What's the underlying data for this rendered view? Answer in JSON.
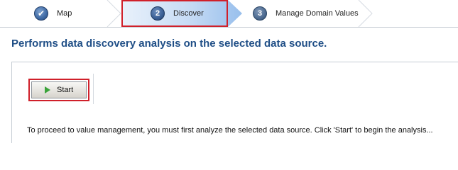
{
  "wizard": {
    "steps": [
      {
        "number": "1",
        "label": "Map",
        "icon": "check-icon",
        "state": "completed"
      },
      {
        "number": "2",
        "label": "Discover",
        "state": "active"
      },
      {
        "number": "3",
        "label": "Manage Domain Values",
        "state": "pending"
      }
    ]
  },
  "main": {
    "title": "Performs data discovery analysis on the selected data source.",
    "toolbar": {
      "start_label": "Start",
      "start_icon": "play-icon"
    },
    "instructions": "To proceed to value management, you must first analyze the selected data source. Click 'Start' to begin the analysis..."
  },
  "colors": {
    "title": "#1f4e86",
    "highlight": "#d0202a",
    "active_step": "#98bfec",
    "play_icon": "#3aa33a"
  }
}
